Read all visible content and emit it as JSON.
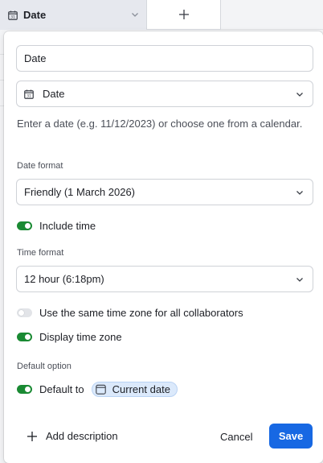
{
  "column_header": {
    "field_name": "Date",
    "field_icon": "calendar-icon",
    "add_icon": "plus-icon"
  },
  "dialog": {
    "name_field": {
      "value": "Date"
    },
    "type_select": {
      "value": "Date",
      "icon": "calendar-icon"
    },
    "help_text": "Enter a date (e.g. 11/12/2023) or choose one from a calendar.",
    "date_format": {
      "label": "Date format",
      "value": "Friendly (1 March 2026)"
    },
    "include_time": {
      "label": "Include time",
      "on": true
    },
    "time_format": {
      "label": "Time format",
      "value": "12 hour (6:18pm)"
    },
    "same_time_zone": {
      "label": "Use the same time zone for all collaborators",
      "on": false
    },
    "display_time_zone": {
      "label": "Display time zone",
      "on": true
    },
    "default_option": {
      "label": "Default option",
      "toggle_label": "Default to",
      "on": true,
      "chip_label": "Current date",
      "chip_icon": "calendar-icon"
    },
    "footer": {
      "add_description": "Add description",
      "cancel": "Cancel",
      "save": "Save"
    }
  },
  "colors": {
    "accent": "#1768e3",
    "toggle_on": "#1a8a33",
    "chip_bg": "#dbe9fb"
  }
}
